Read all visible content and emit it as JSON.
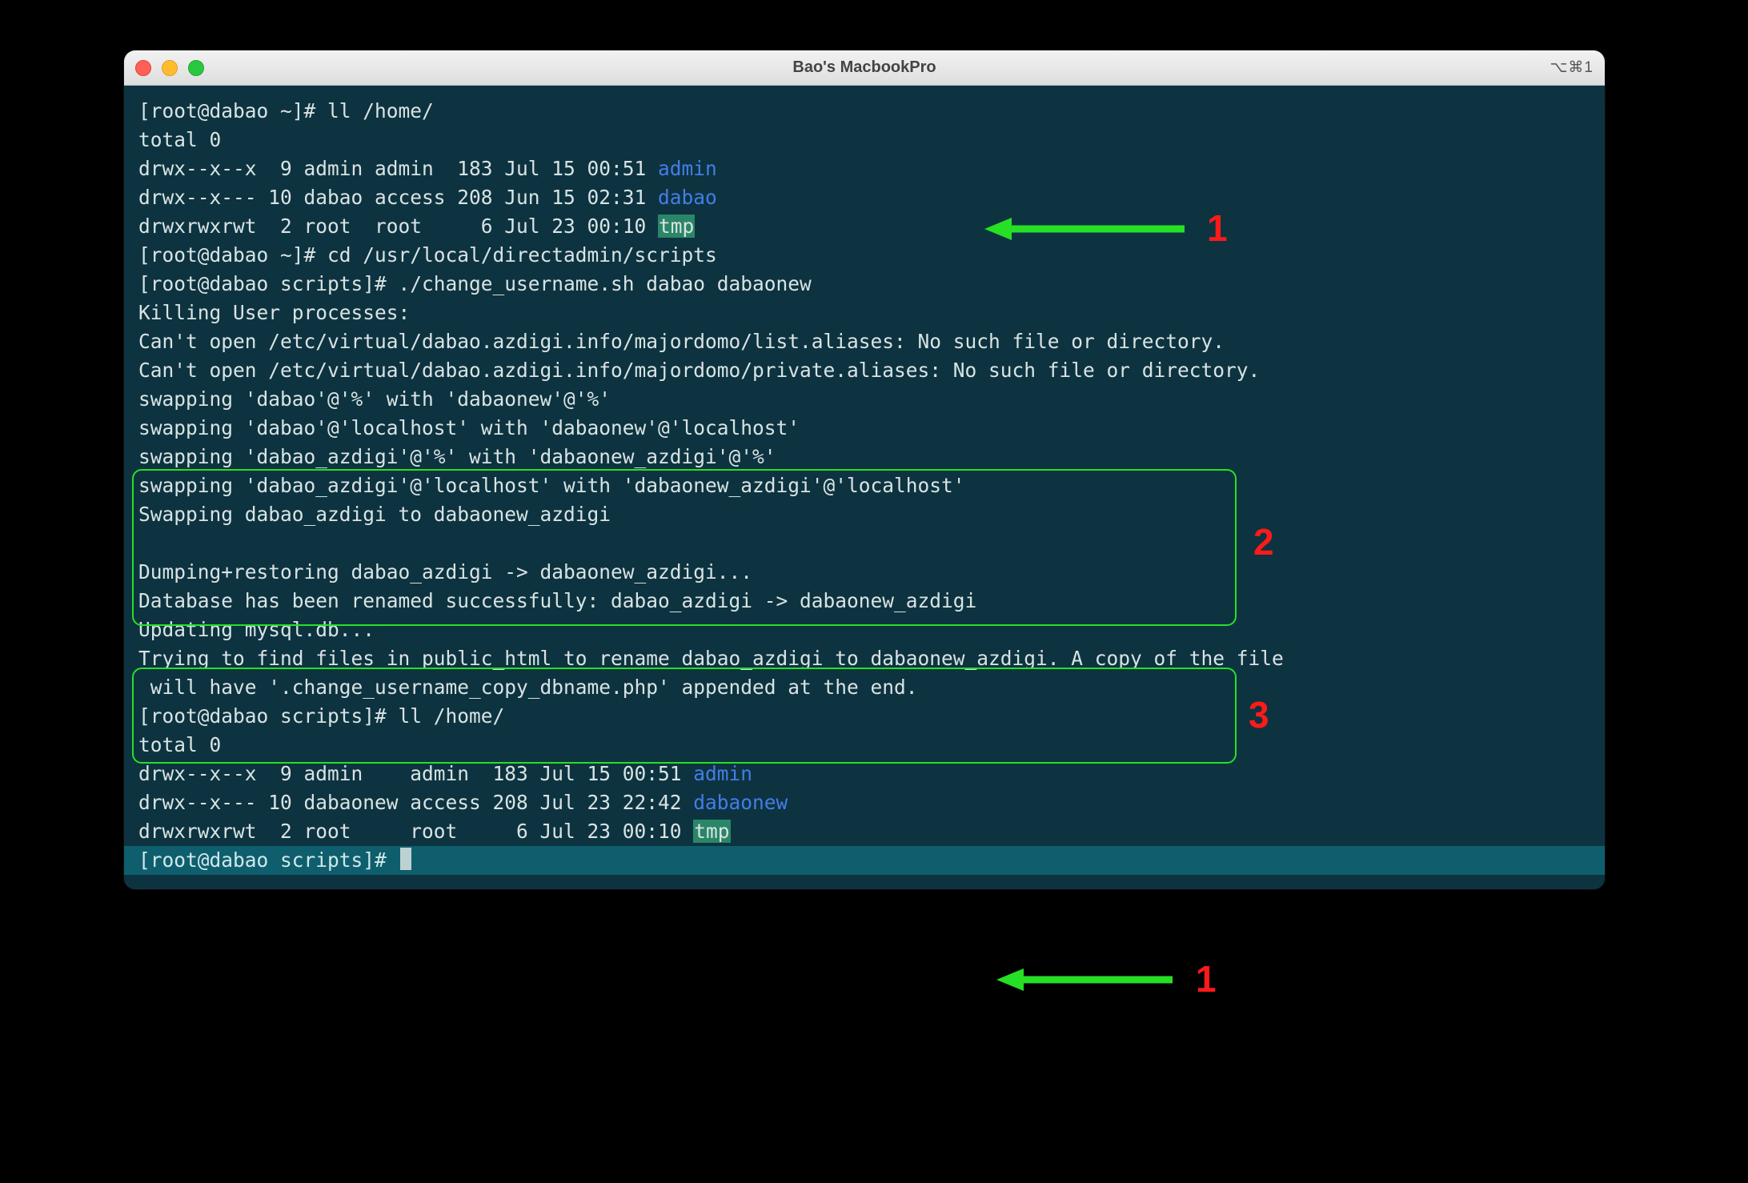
{
  "window": {
    "title": "Bao's MacbookPro",
    "shortcut": "⌥⌘1"
  },
  "terminal": {
    "l1_prompt": "[root@dabao ~]# ",
    "l1_cmd": "ll /home/",
    "l2": "total 0",
    "l3_perm": "drwx--x--x  9 admin admin  183 Jul 15 00:51 ",
    "l3_name": "admin",
    "l4_perm": "drwx--x--- 10 dabao access 208 Jun 15 02:31 ",
    "l4_name": "dabao",
    "l5_perm": "drwxrwxrwt  2 root  root     6 Jul 23 00:10 ",
    "l5_name": "tmp",
    "l6_prompt": "[root@dabao ~]# ",
    "l6_cmd": "cd /usr/local/directadmin/scripts",
    "l7_prompt": "[root@dabao scripts]# ",
    "l7_cmd": "./change_username.sh dabao dabaonew",
    "l8": "Killing User processes:",
    "l9": "Can't open /etc/virtual/dabao.azdigi.info/majordomo/list.aliases: No such file or directory.",
    "l10": "Can't open /etc/virtual/dabao.azdigi.info/majordomo/private.aliases: No such file or directory.",
    "l11": "swapping 'dabao'@'%' with 'dabaonew'@'%'",
    "l12": "swapping 'dabao'@'localhost' with 'dabaonew'@'localhost'",
    "l13": "swapping 'dabao_azdigi'@'%' with 'dabaonew_azdigi'@'%'",
    "l14": "swapping 'dabao_azdigi'@'localhost' with 'dabaonew_azdigi'@'localhost'",
    "l15": "Swapping dabao_azdigi to dabaonew_azdigi",
    "l16": "",
    "l17": "Dumping+restoring dabao_azdigi -> dabaonew_azdigi...",
    "l18": "Database has been renamed successfully: dabao_azdigi -> dabaonew_azdigi",
    "l19": "Updating mysql.db...",
    "l20": "Trying to find files in public_html to rename dabao_azdigi to dabaonew_azdigi. A copy of the file",
    "l21": " will have '.change_username_copy_dbname.php' appended at the end.",
    "l22_prompt": "[root@dabao scripts]# ",
    "l22_cmd": "ll /home/",
    "l23": "total 0",
    "l24_perm": "drwx--x--x  9 admin    admin  183 Jul 15 00:51 ",
    "l24_name": "admin",
    "l25_perm": "drwx--x--- 10 dabaonew access 208 Jul 23 22:42 ",
    "l25_name": "dabaonew",
    "l26_perm": "drwxrwxrwt  2 root     root     6 Jul 23 00:10 ",
    "l26_name": "tmp",
    "l27_prompt": "[root@dabao scripts]# "
  },
  "annotations": {
    "n1": "1",
    "n2": "2",
    "n3": "3",
    "n1b": "1"
  }
}
